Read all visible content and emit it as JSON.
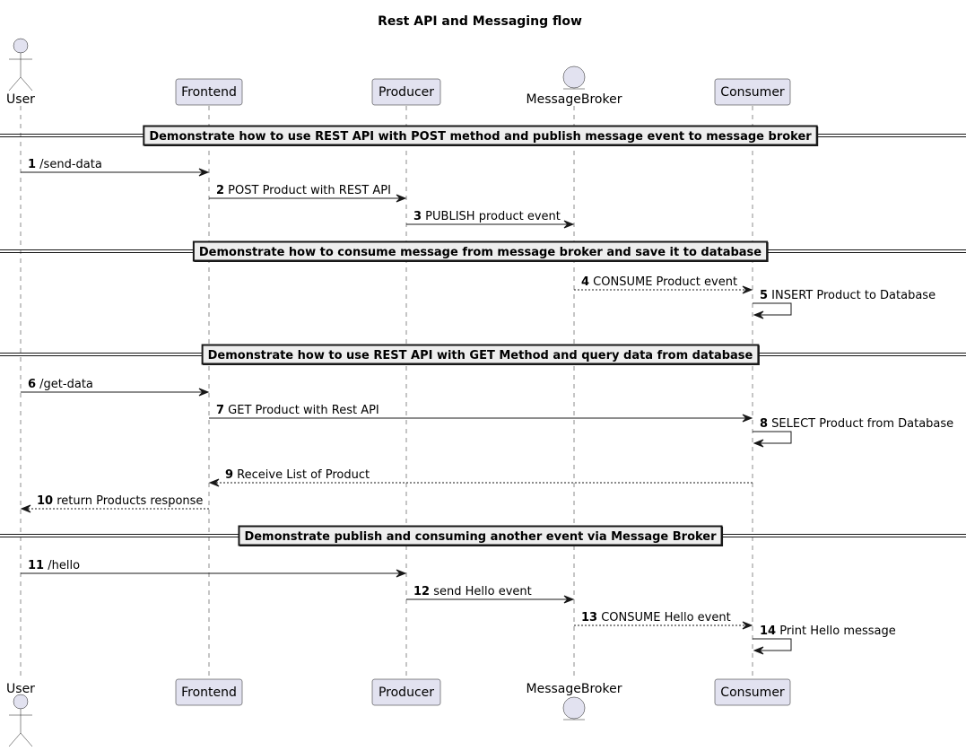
{
  "diagram": {
    "type": "sequence",
    "title": "Rest API and Messaging flow",
    "colors": {
      "participant_fill": "#E2E2F0",
      "participant_border": "#181818",
      "lifeline": "#181818",
      "divider_fill": "#EEEEEE",
      "arrow": "#181818",
      "text": "#000000"
    },
    "participants": [
      {
        "id": "User",
        "label": "User",
        "kind": "actor"
      },
      {
        "id": "Frontend",
        "label": "Frontend",
        "kind": "participant"
      },
      {
        "id": "Producer",
        "label": "Producer",
        "kind": "participant"
      },
      {
        "id": "MessageBroker",
        "label": "MessageBroker",
        "kind": "entity"
      },
      {
        "id": "Consumer",
        "label": "Consumer",
        "kind": "participant"
      }
    ],
    "steps": [
      {
        "kind": "divider",
        "text": "Demonstrate how to use REST API with POST method and publish message event to message broker"
      },
      {
        "kind": "message",
        "num": "1",
        "text": "/send-data",
        "from": "User",
        "to": "Frontend",
        "style": "solid"
      },
      {
        "kind": "message",
        "num": "2",
        "text": "POST Product with REST API",
        "from": "Frontend",
        "to": "Producer",
        "style": "solid"
      },
      {
        "kind": "message",
        "num": "3",
        "text": "PUBLISH product event",
        "from": "Producer",
        "to": "MessageBroker",
        "style": "solid"
      },
      {
        "kind": "divider",
        "text": "Demonstrate how to consume message from message broker and save it to database"
      },
      {
        "kind": "message",
        "num": "4",
        "text": "CONSUME Product event",
        "from": "MessageBroker",
        "to": "Consumer",
        "style": "dashed"
      },
      {
        "kind": "message",
        "num": "5",
        "text": "INSERT Product to Database",
        "from": "Consumer",
        "to": "Consumer",
        "style": "solid"
      },
      {
        "kind": "divider",
        "text": "Demonstrate how to use REST API with GET Method and query data from database"
      },
      {
        "kind": "message",
        "num": "6",
        "text": "/get-data",
        "from": "User",
        "to": "Frontend",
        "style": "solid"
      },
      {
        "kind": "message",
        "num": "7",
        "text": "GET Product with Rest API",
        "from": "Frontend",
        "to": "Consumer",
        "style": "solid"
      },
      {
        "kind": "message",
        "num": "8",
        "text": "SELECT Product from Database",
        "from": "Consumer",
        "to": "Consumer",
        "style": "solid"
      },
      {
        "kind": "message",
        "num": "9",
        "text": "Receive List of Product",
        "from": "Consumer",
        "to": "Frontend",
        "style": "dashed"
      },
      {
        "kind": "message",
        "num": "10",
        "text": "return Products response",
        "from": "Frontend",
        "to": "User",
        "style": "dashed"
      },
      {
        "kind": "divider",
        "text": "Demonstrate publish and consuming another event via Message Broker"
      },
      {
        "kind": "message",
        "num": "11",
        "text": "/hello",
        "from": "User",
        "to": "Producer",
        "style": "solid"
      },
      {
        "kind": "message",
        "num": "12",
        "text": "send Hello event",
        "from": "Producer",
        "to": "MessageBroker",
        "style": "solid"
      },
      {
        "kind": "message",
        "num": "13",
        "text": "CONSUME Hello event",
        "from": "MessageBroker",
        "to": "Consumer",
        "style": "dashed"
      },
      {
        "kind": "message",
        "num": "14",
        "text": "Print Hello message",
        "from": "Consumer",
        "to": "Consumer",
        "style": "solid"
      }
    ]
  }
}
